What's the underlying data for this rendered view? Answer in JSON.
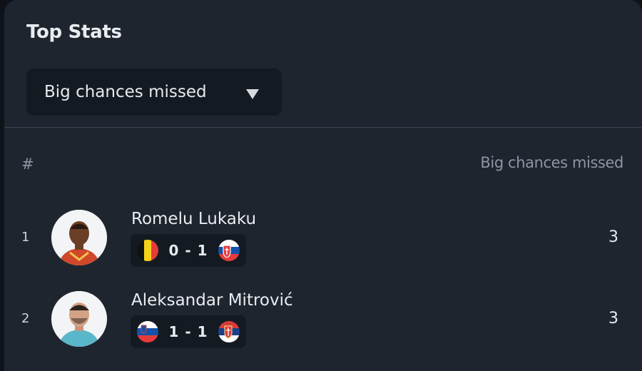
{
  "widget": {
    "title": "Top Stats"
  },
  "selector": {
    "selected": "Big chances missed"
  },
  "table": {
    "rank_header": "#",
    "stat_header": "Big chances missed",
    "rows": [
      {
        "rank": "1",
        "player": "Romelu Lukaku",
        "home_flag": "belgium-flag-icon",
        "score": "0 - 1",
        "away_flag": "slovakia-flag-icon",
        "value": "3"
      },
      {
        "rank": "2",
        "player": "Aleksandar Mitrović",
        "home_flag": "slovenia-flag-icon",
        "score": "1 - 1",
        "away_flag": "serbia-flag-icon",
        "value": "3"
      }
    ]
  }
}
